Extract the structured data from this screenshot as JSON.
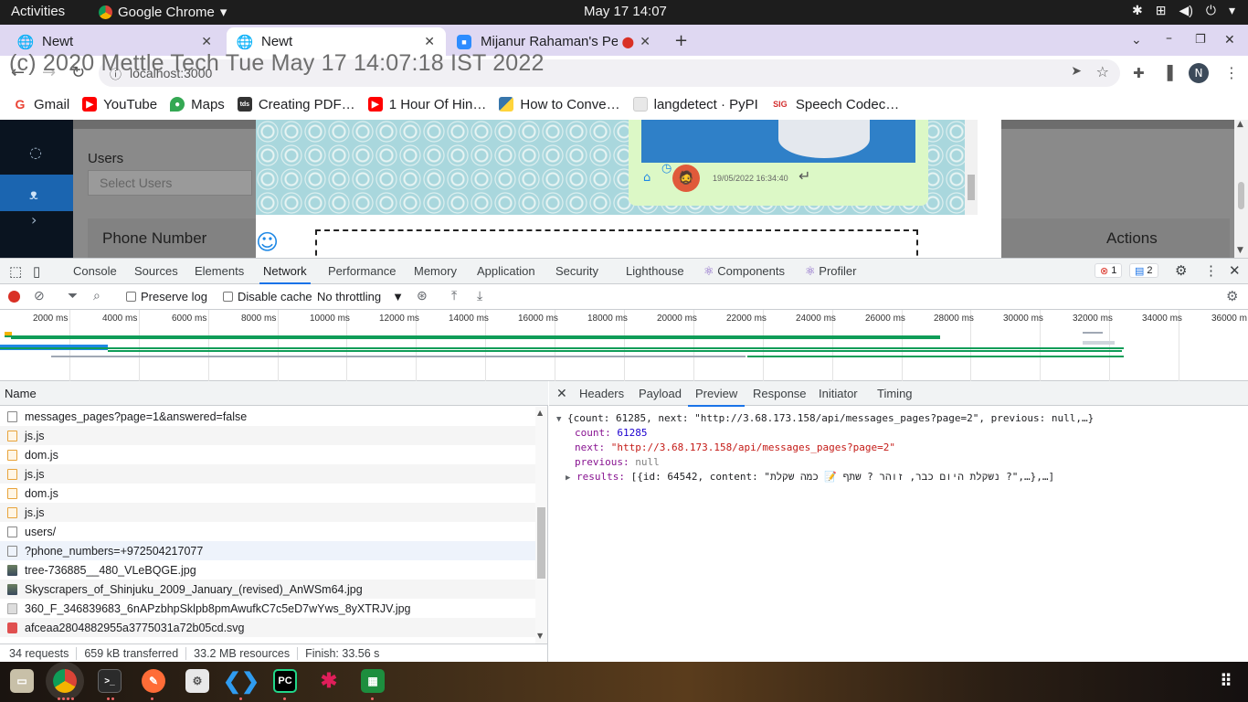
{
  "topbar": {
    "activities": "Activities",
    "app": "Google Chrome",
    "clock": "May 17  14:07"
  },
  "tabs": [
    {
      "title": "Newt"
    },
    {
      "title": "Newt"
    },
    {
      "title": "Mijanur Rahaman's Pe"
    }
  ],
  "omnibox": {
    "url": "localhost:3000"
  },
  "watermark": "(c) 2020 Mettle Tech Tue May 17 14:07:18 IST 2022",
  "profile_initial": "N",
  "bookmarks": [
    {
      "label": "Gmail",
      "icon": "G",
      "color": "#ea4335"
    },
    {
      "label": "YouTube",
      "icon": "▶",
      "color": "#ff0000"
    },
    {
      "label": "Maps",
      "icon": "●",
      "color": "#34a853"
    },
    {
      "label": "Creating PDF…",
      "icon": "tds",
      "color": "#333333"
    },
    {
      "label": "1 Hour Of Hin…",
      "icon": "▶",
      "color": "#ff0000"
    },
    {
      "label": "How to Conve…",
      "icon": "py",
      "color": "#3776ab"
    },
    {
      "label": "langdetect · PyPI",
      "icon": "▢",
      "color": "#dddddd"
    },
    {
      "label": "Speech Codec…",
      "icon": "SIG",
      "color": "#d32f2f"
    }
  ],
  "app": {
    "users_label": "Users",
    "select_placeholder": "Select Users",
    "phone_header": "Phone Number",
    "actions_header": "Actions",
    "message_timestamp": "19/05/2022 16:34:40"
  },
  "devtools": {
    "tabs": [
      "Console",
      "Sources",
      "Elements",
      "Network",
      "Performance",
      "Memory",
      "Application",
      "Security",
      "Lighthouse",
      "Components",
      "Profiler"
    ],
    "active_tab": "Network",
    "errors": "1",
    "messages": "2",
    "toolbar": {
      "preserve_log": "Preserve log",
      "disable_cache": "Disable cache",
      "throttling": "No throttling"
    },
    "timeline_ticks": [
      "2000 ms",
      "4000 ms",
      "6000 ms",
      "8000 ms",
      "10000 ms",
      "12000 ms",
      "14000 ms",
      "16000 ms",
      "18000 ms",
      "20000 ms",
      "22000 ms",
      "24000 ms",
      "26000 ms",
      "28000 ms",
      "30000 ms",
      "32000 ms",
      "34000 ms",
      "36000 m"
    ],
    "name_header": "Name",
    "requests": [
      {
        "name": "messages_pages?page=1&answered=false",
        "type": "doc"
      },
      {
        "name": "js.js",
        "type": "js"
      },
      {
        "name": "dom.js",
        "type": "js"
      },
      {
        "name": "js.js",
        "type": "js"
      },
      {
        "name": "dom.js",
        "type": "js"
      },
      {
        "name": "js.js",
        "type": "js"
      },
      {
        "name": "users/",
        "type": "doc"
      },
      {
        "name": "?phone_numbers=+972504217077",
        "type": "doc"
      },
      {
        "name": "tree-736885__480_VLeBQGE.jpg",
        "type": "img"
      },
      {
        "name": "Skyscrapers_of_Shinjuku_2009_January_(revised)_AnWSm64.jpg",
        "type": "img"
      },
      {
        "name": "360_F_346839683_6nAPzbhpSklpb8pmAwufkC7c5eD7wYws_8yXTRJV.jpg",
        "type": "imglight"
      },
      {
        "name": "afceaa2804882955a3775031a72b05cd.svg",
        "type": "svg"
      }
    ],
    "detail_tabs": [
      "Headers",
      "Payload",
      "Preview",
      "Response",
      "Initiator",
      "Timing"
    ],
    "detail_active": "Preview",
    "preview": {
      "summary": "{count: 61285, next: \"http://3.68.173.158/api/messages_pages?page=2\", previous: null,…}",
      "count_key": "count:",
      "count_val": "61285",
      "next_key": "next:",
      "next_val": "\"http://3.68.173.158/api/messages_pages?page=2\"",
      "previous_key": "previous:",
      "previous_val": "null",
      "results_key": "results:",
      "results_val": "[{id: 64542, content: \"נשקלת היום כבר, זוהר ? שתף 📝 כמה שקלת ?\",…},…]"
    },
    "status": [
      "34 requests",
      "659 kB transferred",
      "33.2 MB resources",
      "Finish: 33.56 s"
    ]
  }
}
